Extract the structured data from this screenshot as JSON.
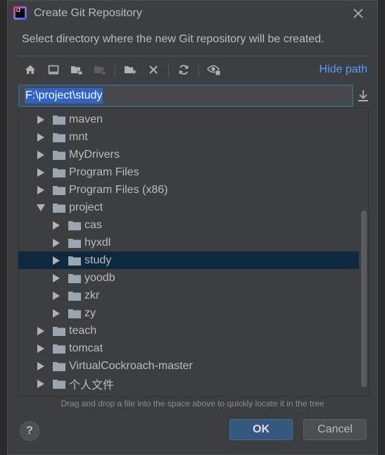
{
  "window": {
    "title": "Create Git Repository",
    "logo_text": "IJ"
  },
  "dialog": {
    "subtitle": "Select directory where the new Git repository will be created.",
    "hide_path_label": "Hide path",
    "path_value": "F:\\project\\study",
    "hint": "Drag and drop a file into the space above to quickly locate it in the tree"
  },
  "toolbar": {
    "buttons": [
      "home-icon",
      "desktop-icon",
      "project-folder-icon",
      "module-folder-icon",
      "new-folder-icon",
      "delete-icon",
      "refresh-icon",
      "show-hidden-icon"
    ]
  },
  "tree": {
    "items": [
      {
        "label": "maven",
        "expanded": false,
        "level": 0
      },
      {
        "label": "mnt",
        "expanded": false,
        "level": 0
      },
      {
        "label": "MyDrivers",
        "expanded": false,
        "level": 0
      },
      {
        "label": "Program Files",
        "expanded": false,
        "level": 0
      },
      {
        "label": "Program Files (x86)",
        "expanded": false,
        "level": 0
      },
      {
        "label": "project",
        "expanded": true,
        "level": 0
      },
      {
        "label": "cas",
        "expanded": false,
        "level": 1
      },
      {
        "label": "hyxdl",
        "expanded": false,
        "level": 1
      },
      {
        "label": "study",
        "expanded": false,
        "level": 1,
        "selected": true
      },
      {
        "label": "yoodb",
        "expanded": false,
        "level": 1
      },
      {
        "label": "zkr",
        "expanded": false,
        "level": 1
      },
      {
        "label": "zy",
        "expanded": false,
        "level": 1
      },
      {
        "label": "teach",
        "expanded": false,
        "level": 0
      },
      {
        "label": "tomcat",
        "expanded": false,
        "level": 0
      },
      {
        "label": "VirtualCockroach-master",
        "expanded": false,
        "level": 0
      },
      {
        "label": "个人文件",
        "expanded": false,
        "level": 0
      }
    ]
  },
  "buttons": {
    "help": "?",
    "ok": "OK",
    "cancel": "Cancel"
  },
  "colors": {
    "dialog_bg": "#3c3f41",
    "accent": "#589df6",
    "selection": "#0d293e",
    "ok_bg": "#365880"
  }
}
